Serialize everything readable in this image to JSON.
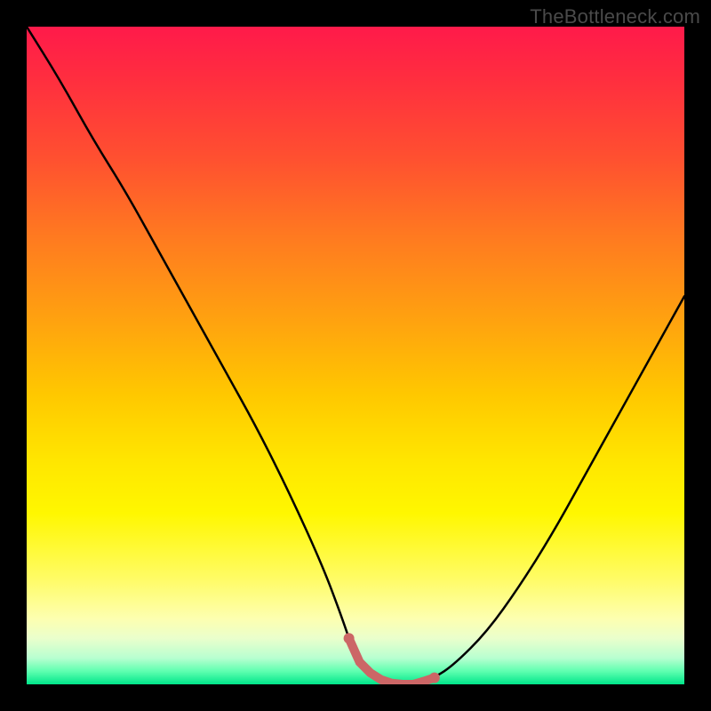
{
  "watermark": "TheBottleneck.com",
  "chart_data": {
    "type": "line",
    "title": "",
    "xlabel": "",
    "ylabel": "",
    "xlim": [
      0,
      100
    ],
    "ylim": [
      0,
      100
    ],
    "x": [
      0,
      5,
      10,
      15,
      20,
      25,
      30,
      35,
      40,
      45,
      48,
      50,
      53,
      56,
      59,
      62,
      65,
      70,
      75,
      80,
      85,
      90,
      95,
      100
    ],
    "values": [
      100,
      92,
      83,
      75,
      66,
      57,
      48,
      39,
      29,
      18,
      10,
      4,
      1,
      0,
      0,
      1,
      3,
      8,
      15,
      23,
      32,
      41,
      50,
      59
    ],
    "flat_region_x": [
      49,
      62
    ],
    "gradient_stops": [
      {
        "pct": 0,
        "color": "#ff1a4a"
      },
      {
        "pct": 8,
        "color": "#ff2e3f"
      },
      {
        "pct": 20,
        "color": "#ff5030"
      },
      {
        "pct": 32,
        "color": "#ff7a20"
      },
      {
        "pct": 44,
        "color": "#ffa010"
      },
      {
        "pct": 56,
        "color": "#ffc800"
      },
      {
        "pct": 66,
        "color": "#ffe600"
      },
      {
        "pct": 74,
        "color": "#fff700"
      },
      {
        "pct": 84,
        "color": "#fffc66"
      },
      {
        "pct": 90,
        "color": "#fdffb0"
      },
      {
        "pct": 93,
        "color": "#eaffcc"
      },
      {
        "pct": 96,
        "color": "#b8ffd0"
      },
      {
        "pct": 98,
        "color": "#5fffb0"
      },
      {
        "pct": 100,
        "color": "#00e68a"
      }
    ],
    "highlight_color": "#cc6666"
  }
}
